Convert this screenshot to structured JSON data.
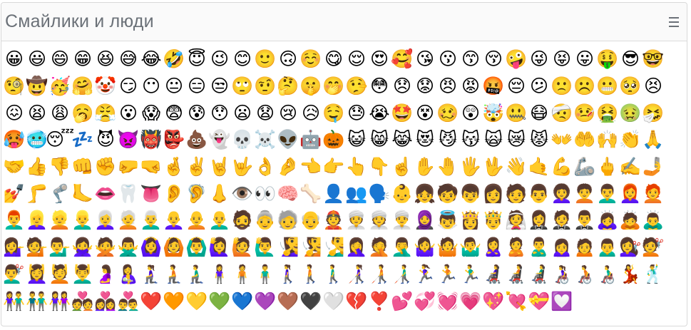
{
  "panel": {
    "title": "Смайлики и люди",
    "menu_icon": "hamburger-menu-icon"
  },
  "emojis": [
    "😀",
    "😃",
    "😄",
    "😁",
    "😆",
    "😅",
    "😂",
    "🤣",
    "😇",
    "😉",
    "😊",
    "🙂",
    "🙃",
    "☺️",
    "😋",
    "😌",
    "😍",
    "🥰",
    "😘",
    "😗",
    "😙",
    "😚",
    "🤪",
    "😜",
    "😝",
    "😛",
    "🤑",
    "😎",
    "🤓",
    "🧐",
    "🤠",
    "🥳",
    "🤗",
    "🤡",
    "😏",
    "😶",
    "😐",
    "😑",
    "😒",
    "🙄",
    "🤨",
    "🤔",
    "🤫",
    "🤭",
    "🤥",
    "😳",
    "😞",
    "😟",
    "😠",
    "😡",
    "🤬",
    "😔",
    "😕",
    "🙁",
    "☹️",
    "😬",
    "🥺",
    "😣",
    "😖",
    "😫",
    "😩",
    "🥱",
    "😤",
    "😮",
    "😱",
    "😨",
    "😰",
    "😯",
    "😦",
    "😧",
    "😢",
    "😥",
    "🤤",
    "😓",
    "😭",
    "🤩",
    "😵",
    "🥴",
    "😲",
    "🤯",
    "🤐",
    "😷",
    "🤕",
    "🤒",
    "🤮",
    "🤢",
    "🤧",
    "🥵",
    "🥶",
    "😴",
    "💤",
    "😈",
    "👿",
    "👹",
    "👺",
    "💩",
    "👻",
    "💀",
    "☠️",
    "👽",
    "🤖",
    "🎃",
    "😺",
    "😸",
    "😹",
    "😻",
    "😼",
    "😽",
    "🙀",
    "😿",
    "😾",
    "👐",
    "🤲",
    "🙌",
    "👏",
    "🙏",
    "🤝",
    "👍",
    "👎",
    "👊",
    "✊",
    "🤛",
    "🤜",
    "🤞",
    "✌️",
    "🤘",
    "🤟",
    "👌",
    "🤌",
    "👈",
    "👉",
    "👆",
    "👇",
    "☝️",
    "✋",
    "🤚",
    "🖐️",
    "🖖",
    "👋",
    "🤙",
    "💪",
    "🦾",
    "🖕",
    "✍️",
    "🤳",
    "💅",
    "🦵",
    "🦿",
    "🦶",
    "👄",
    "🦷",
    "👅",
    "👂",
    "🦻",
    "👃",
    "👁️",
    "👀",
    "🧠",
    "🦴",
    "👤",
    "👥",
    "🗣️",
    "👶",
    "👧",
    "🧒",
    "👦",
    "👩",
    "🧑",
    "👨",
    "👩‍🦱",
    "🧑‍🦱",
    "👨‍🦱",
    "👩‍🦰",
    "🧑‍🦰",
    "👨‍🦰",
    "👱‍♀️",
    "👱",
    "👱‍♂️",
    "👩‍🦳",
    "🧑‍🦳",
    "👨‍🦳",
    "👩‍🦲",
    "🧑‍🦲",
    "👨‍🦲",
    "🧔",
    "👵",
    "🧓",
    "👴",
    "👲",
    "👳‍♀️",
    "👳",
    "👳‍♂️",
    "🧕",
    "👼",
    "👸",
    "🤴",
    "👰",
    "🤵‍♀️",
    "🤵",
    "🤵‍♂️",
    "🙇‍♀️",
    "🙇",
    "🙇‍♂️",
    "💁‍♀️",
    "💁",
    "💁‍♂️",
    "🙅‍♀️",
    "🙅",
    "🙅‍♂️",
    "🙆‍♀️",
    "🙆",
    "🙆‍♂️",
    "🙋‍♀️",
    "🙋",
    "🙋‍♂️",
    "🧏‍♀️",
    "🧏",
    "🧏‍♂️",
    "🤦‍♀️",
    "🤦",
    "🤦‍♂️",
    "🤷‍♀️",
    "🤷",
    "🤷‍♂️",
    "🙎‍♀️",
    "🙎",
    "🙎‍♂️",
    "🙍‍♀️",
    "🙍",
    "🙍‍♂️",
    "💇‍♀️",
    "💇",
    "💇‍♂️",
    "💆‍♀️",
    "💆",
    "💆‍♂️",
    "🤰",
    "🤱",
    "🧎‍♀️",
    "🧎",
    "🧎‍♂️",
    "🧍‍♀️",
    "🧍",
    "🧍‍♂️",
    "🚶‍♀️",
    "🚶",
    "🚶‍♂️",
    "👩‍🦯",
    "🧑‍🦯",
    "👨‍🦯",
    "🏃‍♀️",
    "🏃",
    "🏃‍♂️",
    "👩‍🦼",
    "🧑‍🦼",
    "👨‍🦼",
    "👩‍🦽",
    "🧑‍🦽",
    "👨‍🦽",
    "💃",
    "🕺",
    "👫",
    "👬",
    "👭",
    "💑",
    "👩‍❤️‍👩",
    "👨‍❤️‍👨",
    "❤️",
    "🧡",
    "💛",
    "💚",
    "💙",
    "💜",
    "🤎",
    "🖤",
    "🤍",
    "💔",
    "❣️",
    "💕",
    "💞",
    "💓",
    "💗",
    "💖",
    "💘",
    "💝",
    "💟"
  ]
}
